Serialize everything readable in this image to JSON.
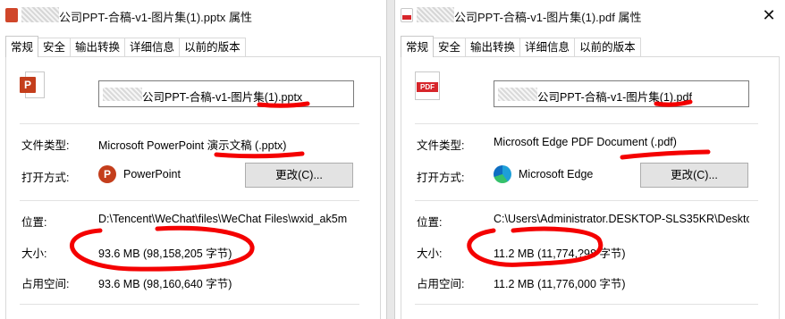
{
  "left_window": {
    "title": "公司PPT-合稿-v1-图片集(1).pptx 属性",
    "tabs": [
      "常规",
      "安全",
      "输出转换",
      "详细信息",
      "以前的版本"
    ],
    "file_name": "公司PPT-合稿-v1-图片集(1).pptx",
    "labels": {
      "file_type": "文件类型:",
      "open_with": "打开方式:",
      "location": "位置:",
      "size": "大小:",
      "size_on_disk": "占用空间:"
    },
    "file_type": "Microsoft PowerPoint 演示文稿 (.pptx)",
    "open_with_app": "PowerPoint",
    "change_button": "更改(C)...",
    "location": "D:\\Tencent\\WeChat\\files\\WeChat Files\\wxid_ak5m",
    "size": "93.6 MB (98,158,205 字节)",
    "size_on_disk": "93.6 MB (98,160,640 字节)",
    "icons": {
      "file": "powerpoint-file-icon",
      "app": "powerpoint-app-icon"
    }
  },
  "right_window": {
    "title": "公司PPT-合稿-v1-图片集(1).pdf 属性",
    "tabs": [
      "常规",
      "安全",
      "输出转换",
      "详细信息",
      "以前的版本"
    ],
    "file_name": "公司PPT-合稿-v1-图片集(1).pdf",
    "labels": {
      "file_type": "文件类型:",
      "open_with": "打开方式:",
      "location": "位置:",
      "size": "大小:",
      "size_on_disk": "占用空间:"
    },
    "file_type": "Microsoft Edge PDF Document (.pdf)",
    "open_with_app": "Microsoft Edge",
    "change_button": "更改(C)...",
    "location": "C:\\Users\\Administrator.DESKTOP-SLS35KR\\Deskto",
    "size": "11.2 MB (11,774,?98 字节)",
    "size_on_disk": "11.2 MB (11,776,000 字节)",
    "icons": {
      "file": "pdf-file-icon",
      "app": "edge-app-icon"
    }
  },
  "colors": {
    "annotation_red": "#f40000",
    "powerpoint_orange": "#c43e1c",
    "pdf_red": "#d7262b",
    "button_gray": "#e3e3e3"
  }
}
